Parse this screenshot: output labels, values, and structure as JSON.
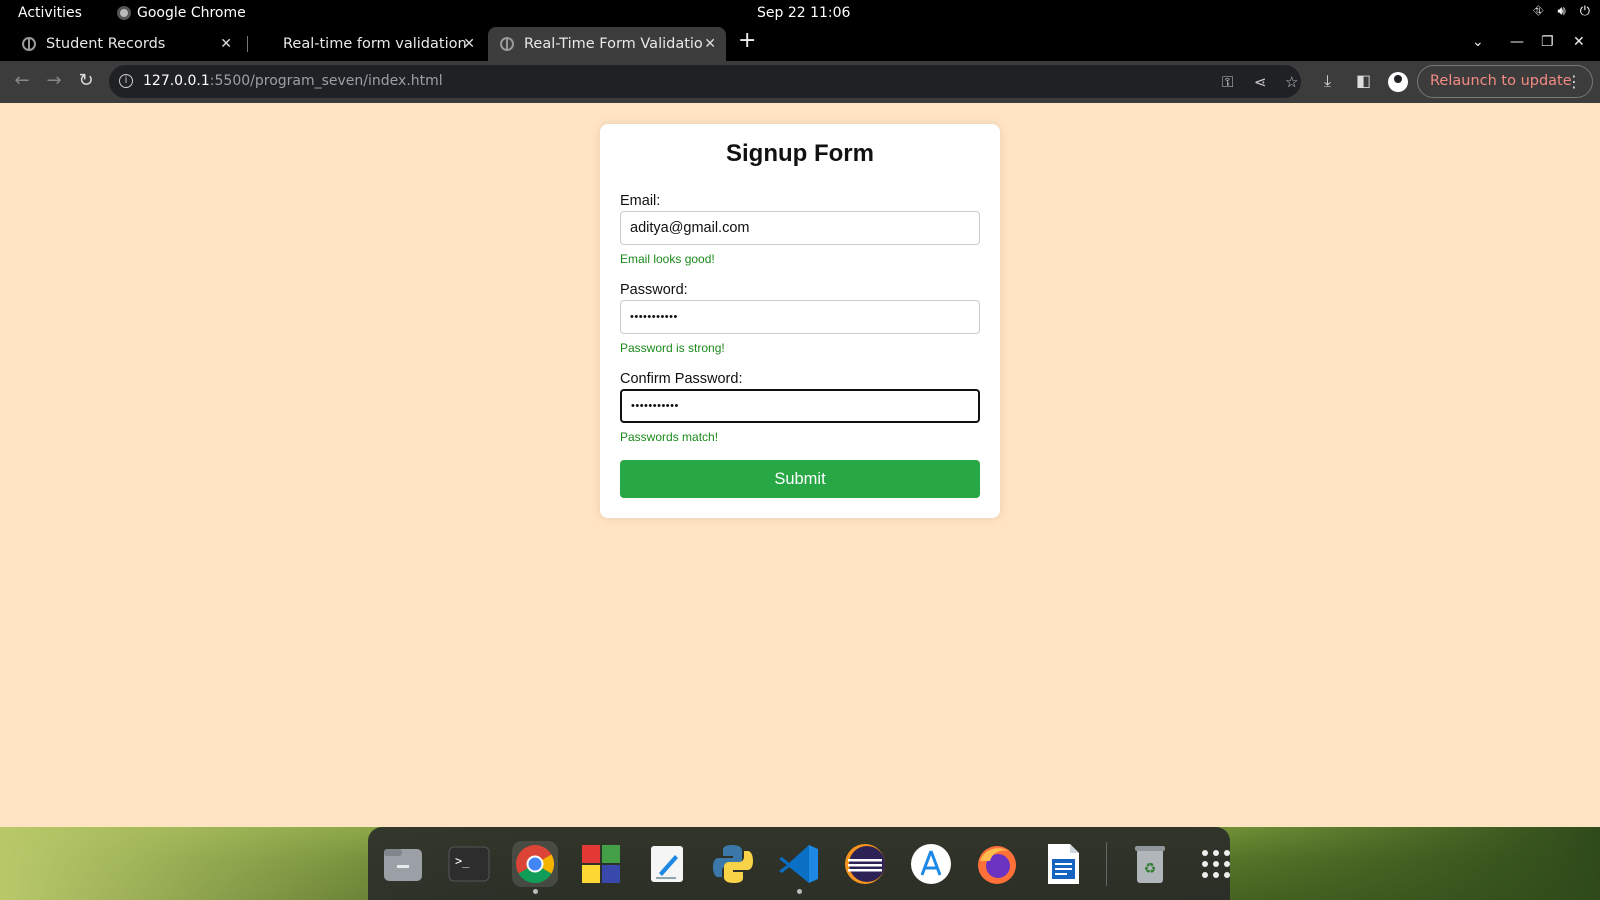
{
  "system": {
    "activities": "Activities",
    "app_name": "Google Chrome",
    "clock": "Sep 22  11:06"
  },
  "tabs": [
    {
      "label": "Student Records",
      "active": false
    },
    {
      "label": "Real-time form validation",
      "active": false
    },
    {
      "label": "Real-Time Form Validatio",
      "active": true
    }
  ],
  "toolbar": {
    "url_host": "127.0.0.1",
    "url_path": ":5500/program_seven/index.html",
    "relaunch_label": "Relaunch to update"
  },
  "form": {
    "title": "Signup Form",
    "email_label": "Email:",
    "email_value": "aditya@gmail.com",
    "email_msg": "Email looks good!",
    "password_label": "Password:",
    "password_value": "•••••••••••",
    "password_msg": "Password is strong!",
    "confirm_label": "Confirm Password:",
    "confirm_value": "•••••••••••",
    "confirm_msg": "Passwords match!",
    "submit_label": "Submit",
    "page_bg": "#ffe4c4",
    "success_color": "#1a8a1a",
    "button_color": "#28a745"
  },
  "dock": {
    "items": [
      "files-icon",
      "terminal-icon",
      "chrome-icon",
      "app-grid-colored-icon",
      "text-editor-icon",
      "python-icon",
      "vscode-icon",
      "eclipse-icon",
      "app-store-icon",
      "firefox-icon",
      "writer-icon",
      "trash-icon",
      "show-apps-icon"
    ]
  }
}
